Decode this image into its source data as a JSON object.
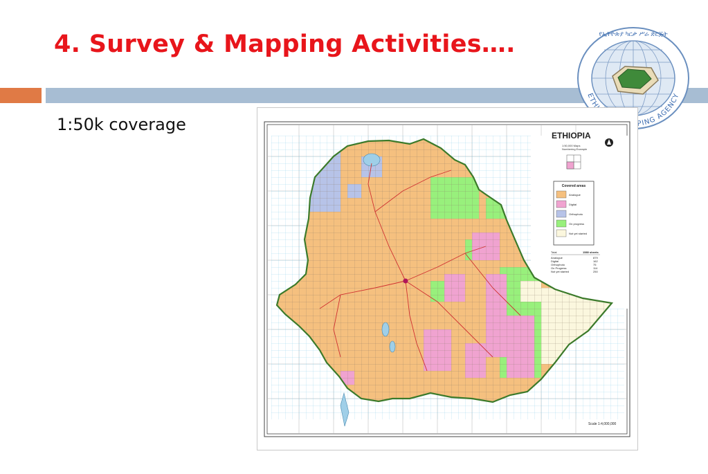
{
  "slide": {
    "title": "4. Survey & Mapping Activities….",
    "subtitle": "1:50k coverage"
  },
  "logo": {
    "ring_text": "ETHIOPIAN MAPPING AGENCY"
  },
  "map": {
    "country": "ETHIOPIA",
    "numbering_caption_1": "1:50,000 Maps",
    "numbering_caption_2": "Numbering Example",
    "legend": {
      "title": "Covered areas",
      "items": [
        {
          "label": "Analogue",
          "color": "#f5c07f"
        },
        {
          "label": "Digital",
          "color": "#f0a3d0"
        },
        {
          "label": "Orthophoto",
          "color": "#b7c3e8"
        },
        {
          "label": "On progress",
          "color": "#98f07c"
        },
        {
          "label": "Not yet started",
          "color": "#fbf7de"
        }
      ]
    },
    "stats": {
      "total_label": "Total",
      "total_value": "1580 sheets",
      "rows": [
        {
          "label": "Analogue",
          "value": "879"
        },
        {
          "label": "Digital",
          "value": "162"
        },
        {
          "label": "Orthophoto",
          "value": "75"
        },
        {
          "label": "On Progress",
          "value": "114"
        },
        {
          "label": "Not yet started",
          "value": "250"
        }
      ]
    },
    "scale": "Scale 1:4,000,000"
  }
}
